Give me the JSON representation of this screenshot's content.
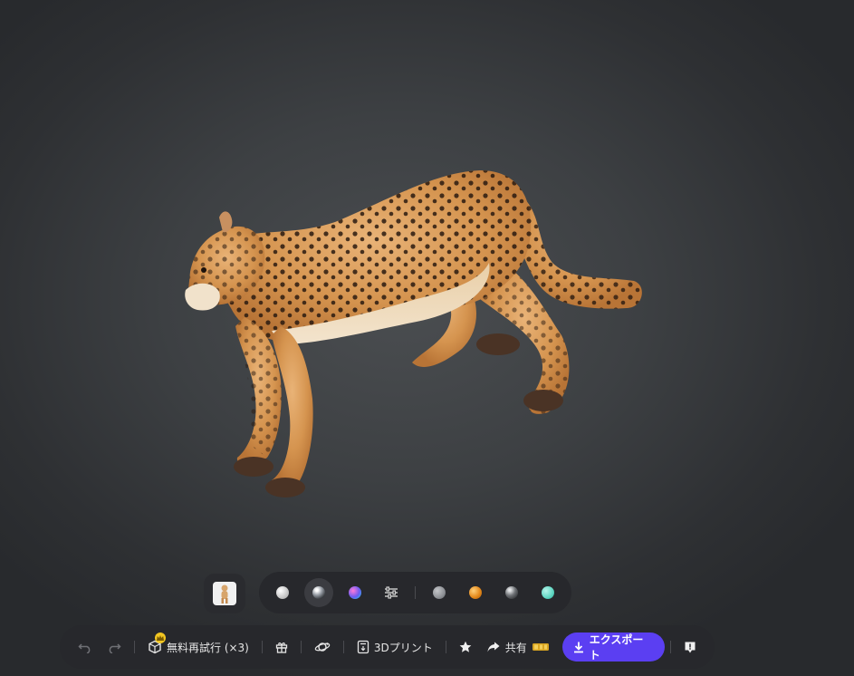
{
  "model": {
    "subject": "cheetah",
    "icon": "cheetah-3d-model"
  },
  "thumbnail": {
    "icon": "model-thumbnail-icon"
  },
  "materials": {
    "items": [
      {
        "name": "matte-white",
        "color": "#d8d8d8"
      },
      {
        "name": "glossy-chrome",
        "color": "#bfc3c8",
        "active": true
      },
      {
        "name": "iridescent",
        "color": "#6a5cf2"
      },
      {
        "name": "adjust",
        "icon": "sliders-icon"
      },
      {
        "name": "gray",
        "color": "#8e9196"
      },
      {
        "name": "orange",
        "color": "#e58a1c"
      },
      {
        "name": "dark-metal",
        "color": "#6f7276"
      },
      {
        "name": "teal",
        "color": "#5fd6c2"
      }
    ]
  },
  "toolbar": {
    "undo_icon": "undo-icon",
    "redo_icon": "redo-icon",
    "retry_label": "無料再試行 (×3)",
    "gift_icon": "gift-icon",
    "orbit_icon": "orbit-icon",
    "print_label": "3Dプリント",
    "favorite_icon": "star-icon",
    "share_label": "共有",
    "export_label": "エクスポート",
    "feedback_icon": "feedback-icon"
  },
  "colors": {
    "accent": "#5b3ff2",
    "crown": "#f2c622"
  }
}
